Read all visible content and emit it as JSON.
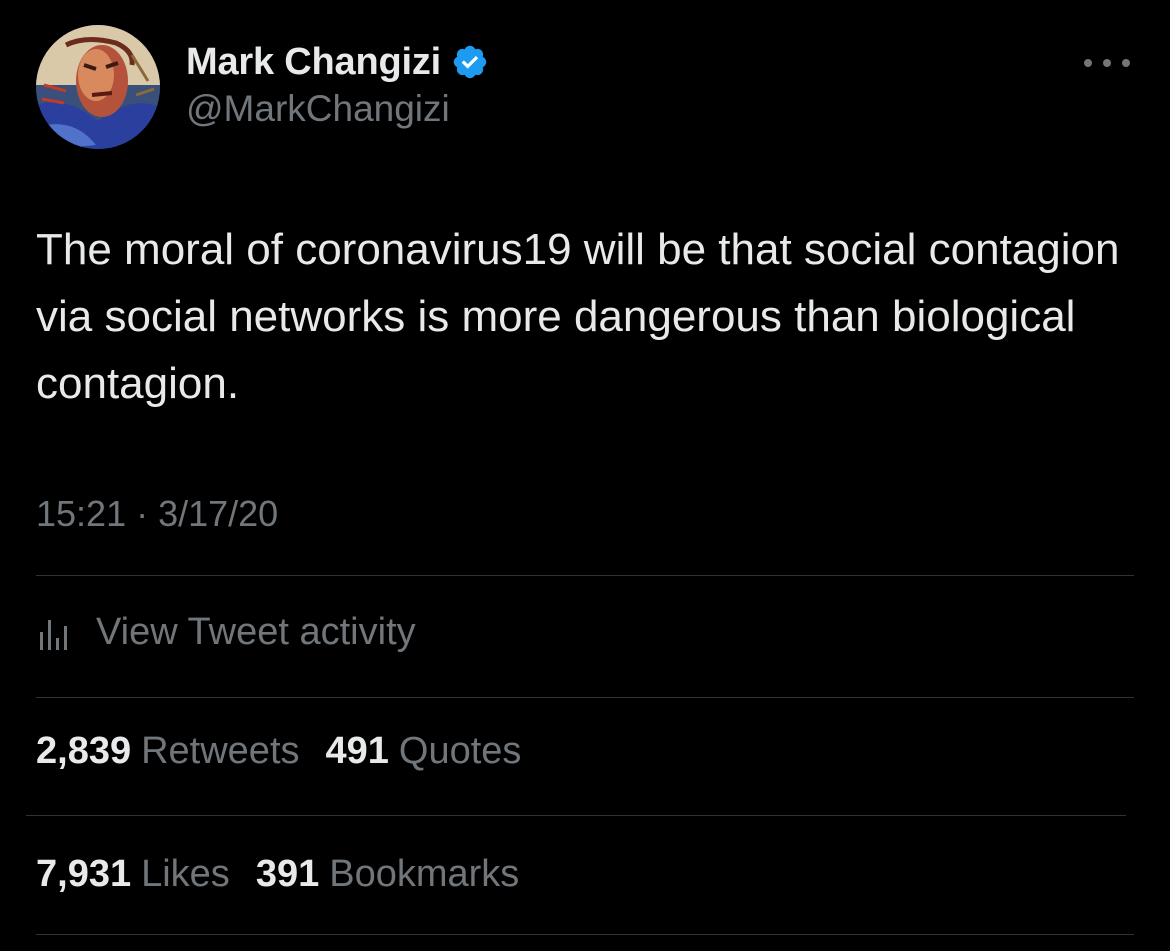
{
  "author": {
    "display_name": "Mark Changizi",
    "handle": "@MarkChangizi",
    "verified": true,
    "verified_color": "#1d9bf0"
  },
  "tweet": {
    "text": "The moral of coronavirus19 will be that social contagion via social networks is more dangerous than biological contagion.",
    "timestamp": "15:21 · 3/17/20"
  },
  "activity": {
    "label": "View Tweet activity",
    "icon": "bar-chart-icon"
  },
  "stats": {
    "retweets": {
      "count": "2,839",
      "label": "Retweets"
    },
    "quotes": {
      "count": "491",
      "label": "Quotes"
    },
    "likes": {
      "count": "7,931",
      "label": "Likes"
    },
    "bookmarks": {
      "count": "391",
      "label": "Bookmarks"
    }
  },
  "colors": {
    "background": "#000000",
    "text": "#e7e9ea",
    "secondary_text": "#71767b",
    "divider": "#2f3336"
  }
}
